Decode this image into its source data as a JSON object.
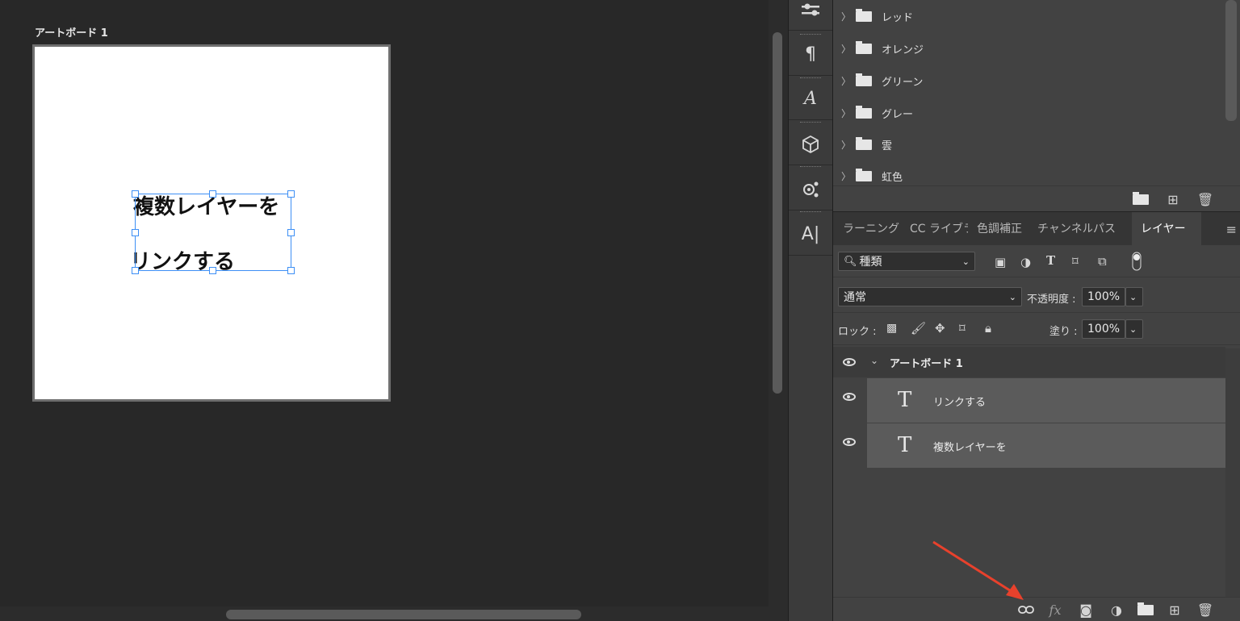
{
  "canvas": {
    "artboard_label": "アートボード 1",
    "text_line1": "複数レイヤーを",
    "text_line2": "リンクする"
  },
  "swatches": {
    "groups": [
      {
        "label": "レッド"
      },
      {
        "label": "オレンジ"
      },
      {
        "label": "グリーン"
      },
      {
        "label": "グレー"
      },
      {
        "label": "雲"
      },
      {
        "label": "虹色"
      }
    ]
  },
  "tabs": [
    {
      "label": "ラーニング"
    },
    {
      "label": "CC ライブラリ"
    },
    {
      "label": "色調補正"
    },
    {
      "label": "チャンネル"
    },
    {
      "label": "パス"
    },
    {
      "label": "レイヤー"
    }
  ],
  "layers": {
    "filter_label": "種類",
    "blend_mode": "通常",
    "opacity_label": "不透明度 :",
    "opacity_value": "100%",
    "lock_label": "ロック :",
    "fill_label": "塗り :",
    "fill_value": "100%",
    "group_name": "アートボード 1",
    "items": [
      {
        "name": "リンクする"
      },
      {
        "name": "複数レイヤーを"
      }
    ]
  },
  "colors": {
    "annotation_arrow": "#e8412c",
    "selection": "#3d8ff5"
  }
}
